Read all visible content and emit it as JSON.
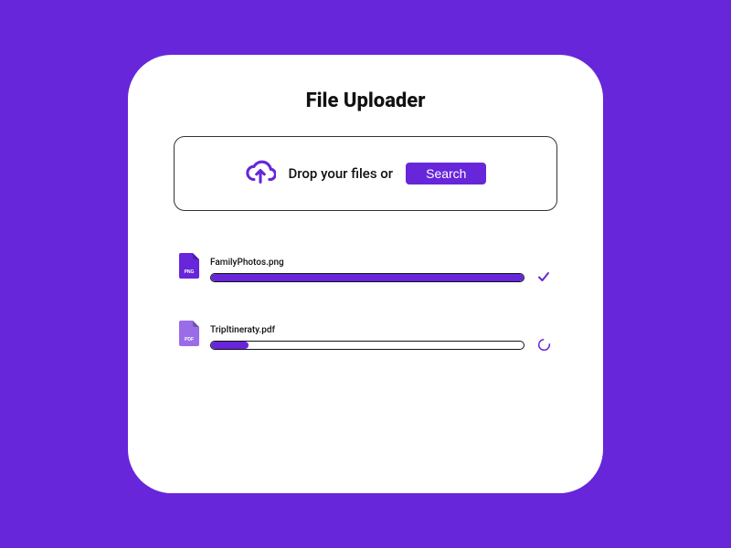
{
  "title": "File Uploader",
  "dropzone": {
    "label": "Drop your files or",
    "button": "Search"
  },
  "colors": {
    "accent": "#6726da",
    "accent_light": "#9a6ce8"
  },
  "files": [
    {
      "name": "FamilyPhotos.png",
      "type_label": "PNG",
      "progress": 100,
      "status": "complete",
      "icon_color": "#6726da"
    },
    {
      "name": "TripItineraty.pdf",
      "type_label": "PDF",
      "progress": 12,
      "status": "uploading",
      "icon_color": "#9a6ce8"
    }
  ]
}
